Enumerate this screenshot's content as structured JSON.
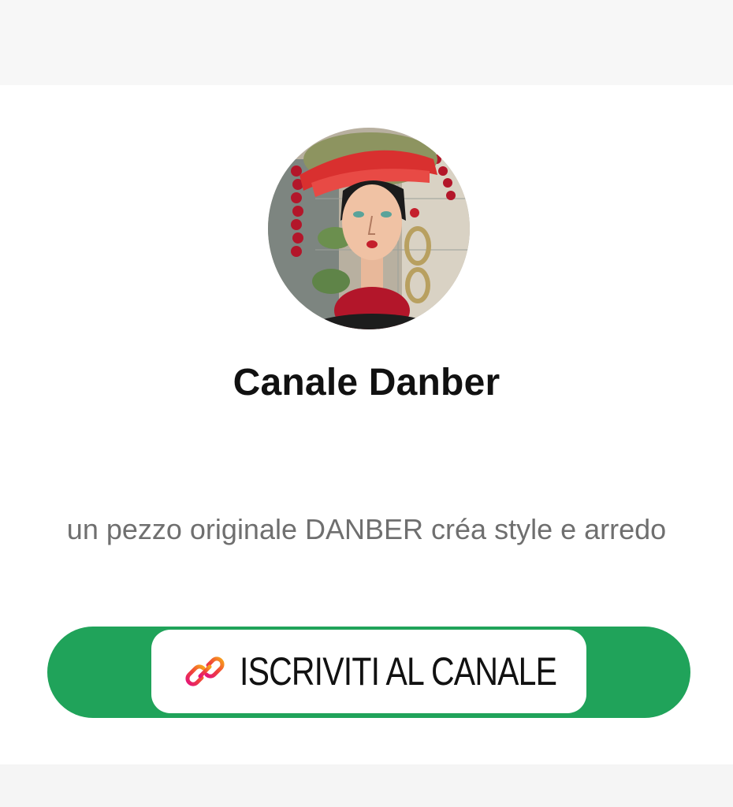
{
  "channel": {
    "name": "Canale Danber",
    "description": "un pezzo originale DANBER créa style e arredo",
    "avatar_icon": "painted-portrait-avatar"
  },
  "subscribe": {
    "label": "ISCRIVITI AL CANALE",
    "icon": "link-icon"
  },
  "colors": {
    "accent_green": "#20a35a",
    "description_gray": "#6f6f6f",
    "title_black": "#111111"
  }
}
